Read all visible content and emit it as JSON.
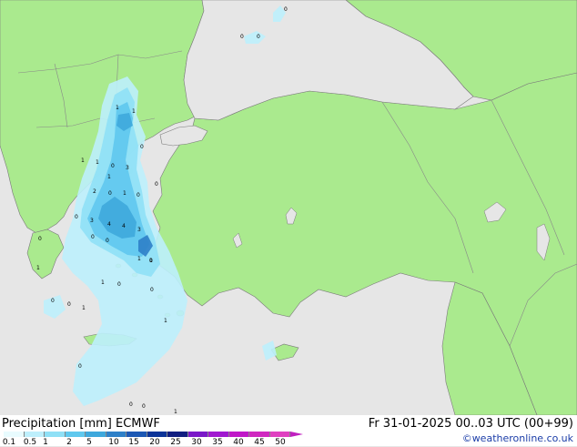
{
  "header": {
    "precip_label": "Precipitation [mm]",
    "model": "ECMWF",
    "valid_time": "Fr 31-01-2025 00..03 UTC (00+99)",
    "credit": "©weatheronline.co.uk"
  },
  "legend": {
    "labels": [
      "0.1",
      "0.5",
      "1",
      "2",
      "5",
      "10",
      "15",
      "20",
      "25",
      "30",
      "35",
      "40",
      "45",
      "50"
    ],
    "colors": [
      "#e8fbfe",
      "#bdeffc",
      "#8fe0f6",
      "#5fc8ee",
      "#3ea8dc",
      "#2e80c8",
      "#1c58b4",
      "#0c3498",
      "#101e80",
      "#7a18c8",
      "#a018d0",
      "#c018c8",
      "#d028c0",
      "#e040c0"
    ]
  },
  "colors": {
    "sea": "#e6e6e6",
    "land": "#aaea8e",
    "border": "#888888",
    "coast": "#7a7a7a"
  },
  "point_labels": [
    "0",
    "0",
    "0",
    "1",
    "1",
    "1",
    "1",
    "0",
    "3",
    "1",
    "2",
    "0",
    "1",
    "0",
    "3",
    "4",
    "4",
    "0",
    "0",
    "3",
    "1",
    "1",
    "1",
    "0",
    "0",
    "0",
    "1",
    "0",
    "1",
    "0",
    "0",
    "0",
    "1",
    "0",
    "1",
    "0",
    "0",
    "0",
    "0"
  ]
}
